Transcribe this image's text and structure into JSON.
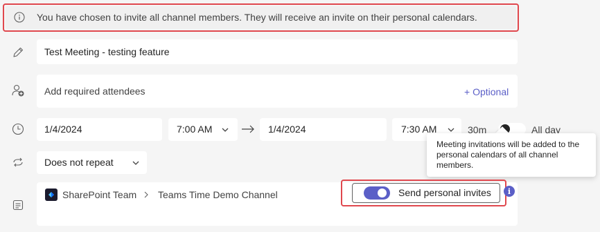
{
  "banner": {
    "text": "You have chosen to invite all channel members. They will receive an invite on their personal calendars."
  },
  "title": {
    "value": "Test Meeting - testing feature"
  },
  "attendees": {
    "placeholder": "Add required attendees",
    "optional_label": "+ Optional"
  },
  "schedule": {
    "start_date": "1/4/2024",
    "start_time": "7:00 AM",
    "end_date": "1/4/2024",
    "end_time": "7:30 AM",
    "duration": "30m",
    "all_day_label": "All day",
    "all_day_on": false
  },
  "tooltip": {
    "text": "Meeting invitations will be added to the personal calendars of all channel members."
  },
  "repeat": {
    "value": "Does not repeat"
  },
  "channel": {
    "team": "SharePoint Team",
    "separator": ">",
    "channel_name": "Teams Time Demo Channel"
  },
  "invites": {
    "label": "Send personal invites",
    "toggle_on": true,
    "info_glyph": "i"
  },
  "colors": {
    "accent": "#5b5fc7",
    "highlight_border": "#e0474d"
  }
}
